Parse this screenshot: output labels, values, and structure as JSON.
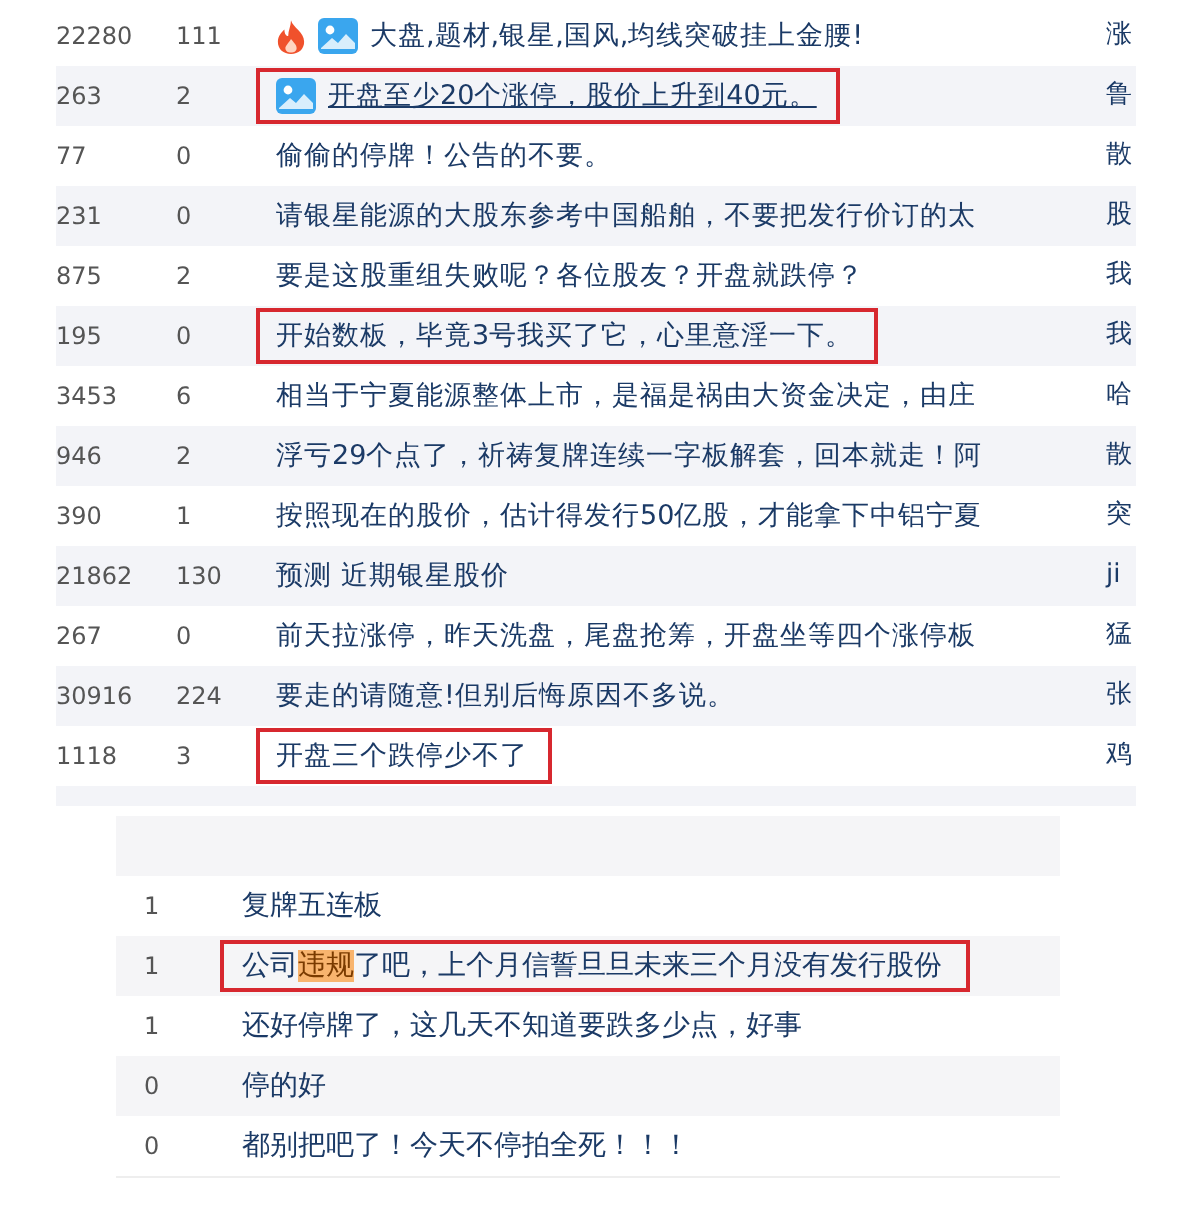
{
  "topic_list": {
    "rows": [
      {
        "column_1": "22280",
        "column_2": "111",
        "badges": [
          {
            "kind": "hot"
          },
          {
            "kind": "image"
          }
        ],
        "title": "大盘,题材,银星,国风,均线突破挂上金腰!",
        "underlined": false,
        "framed": false,
        "column_4": "涨"
      },
      {
        "column_1": "263",
        "column_2": "2",
        "badges": [
          {
            "kind": "image"
          }
        ],
        "title": "开盘至少20个涨停，股价上升到40元。",
        "underlined": true,
        "framed": true,
        "column_4": "鲁"
      },
      {
        "column_1": "77",
        "column_2": "0",
        "title": "偷偷的停牌！公告的不要。",
        "underlined": false,
        "framed": false,
        "column_4": "散"
      },
      {
        "column_1": "231",
        "column_2": "0",
        "title": "请银星能源的大股东参考中国船舶，不要把发行价订的太",
        "underlined": false,
        "framed": false,
        "column_4": "股"
      },
      {
        "column_1": "875",
        "column_2": "2",
        "title": "要是这股重组失败呢？各位股友？开盘就跌停？",
        "underlined": false,
        "framed": false,
        "column_4": "我"
      },
      {
        "column_1": "195",
        "column_2": "0",
        "title": "开始数板，毕竟3号我买了它，心里意淫一下。",
        "underlined": false,
        "framed": true,
        "column_4": "我"
      },
      {
        "column_1": "3453",
        "column_2": "6",
        "title": "相当于宁夏能源整体上市，是福是祸由大资金决定，由庄",
        "underlined": false,
        "framed": false,
        "column_4": "哈"
      },
      {
        "column_1": "946",
        "column_2": "2",
        "title": "浮亏29个点了，祈祷复牌连续一字板解套，回本就走！阿",
        "underlined": false,
        "framed": false,
        "column_4": "散"
      },
      {
        "column_1": "390",
        "column_2": "1",
        "title": "按照现在的股价，估计得发行50亿股，才能拿下中铝宁夏",
        "underlined": false,
        "framed": false,
        "column_4": "突"
      },
      {
        "column_1": "21862",
        "column_2": "130",
        "title": "预测 近期银星股价",
        "underlined": false,
        "framed": false,
        "column_4": "ji"
      },
      {
        "column_1": "267",
        "column_2": "0",
        "title": "前天拉涨停，昨天洗盘，尾盘抢筹，开盘坐等四个涨停板",
        "underlined": false,
        "framed": false,
        "column_4": "猛"
      },
      {
        "column_1": "30916",
        "column_2": "224",
        "title": "要走的请随意!但别后悔原因不多说。",
        "underlined": false,
        "framed": false,
        "column_4": "张"
      },
      {
        "column_1": "1118",
        "column_2": "3",
        "title": "开盘三个跌停少不了",
        "underlined": false,
        "framed": true,
        "column_4": "鸡"
      }
    ]
  },
  "reply_list": {
    "rows": [
      {
        "column_1": "1",
        "title": [
          {
            "text": "复牌五连板",
            "marked": false
          }
        ],
        "framed": false
      },
      {
        "column_1": "1",
        "title": [
          {
            "text": "公司",
            "marked": false
          },
          {
            "text": "违规",
            "marked": true
          },
          {
            "text": "了吧，上个月信誓旦旦未来三个月没有发行股份",
            "marked": false
          }
        ],
        "framed": true
      },
      {
        "column_1": "1",
        "title": [
          {
            "text": "还好停牌了，这几天不知道要跌多少点，好事",
            "marked": false
          }
        ],
        "framed": false
      },
      {
        "column_1": "0",
        "title": [
          {
            "text": "停的好",
            "marked": false
          }
        ],
        "framed": false
      },
      {
        "column_1": "0",
        "title": [
          {
            "text": "都别把吧了！今天不停拍全死！！！",
            "marked": false
          }
        ],
        "framed": false
      }
    ]
  }
}
